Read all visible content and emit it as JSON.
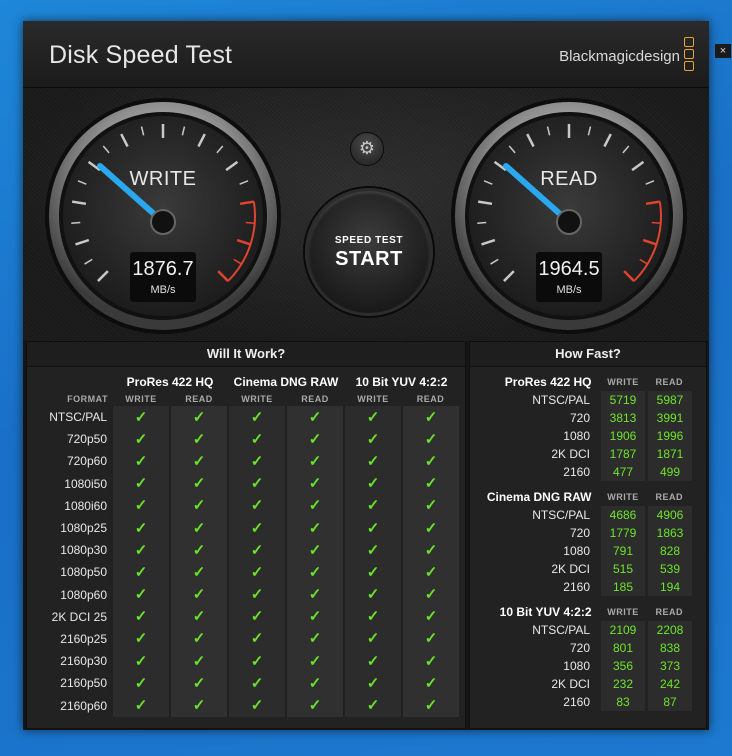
{
  "app": {
    "title": "Disk Speed Test",
    "brand": "Blackmagicdesign",
    "close_label": "×",
    "accent_color": "#e7a23a"
  },
  "gauges": {
    "write": {
      "label": "WRITE",
      "value": "1876.7",
      "unit": "MB/s"
    },
    "read": {
      "label": "READ",
      "value": "1964.5",
      "unit": "MB/s"
    }
  },
  "controls": {
    "settings_icon": "gear-icon",
    "start_small": "SPEED TEST",
    "start_big": "START"
  },
  "will_it_work": {
    "title": "Will It Work?",
    "format_header": "FORMAT",
    "write_label": "WRITE",
    "read_label": "READ",
    "check_mark": "✓",
    "check_color": "#69e22b",
    "codecs": [
      "ProRes 422 HQ",
      "Cinema DNG RAW",
      "10 Bit YUV 4:2:2"
    ],
    "formats": [
      "NTSC/PAL",
      "720p50",
      "720p60",
      "1080i50",
      "1080i60",
      "1080p25",
      "1080p30",
      "1080p50",
      "1080p60",
      "2K DCI 25",
      "2160p25",
      "2160p30",
      "2160p50",
      "2160p60"
    ]
  },
  "how_fast": {
    "title": "How Fast?",
    "write_label": "WRITE",
    "read_label": "READ",
    "sections": [
      {
        "codec": "ProRes 422 HQ",
        "rows": [
          {
            "label": "NTSC/PAL",
            "write": "5719",
            "read": "5987"
          },
          {
            "label": "720",
            "write": "3813",
            "read": "3991"
          },
          {
            "label": "1080",
            "write": "1906",
            "read": "1996"
          },
          {
            "label": "2K DCI",
            "write": "1787",
            "read": "1871"
          },
          {
            "label": "2160",
            "write": "477",
            "read": "499"
          }
        ]
      },
      {
        "codec": "Cinema DNG RAW",
        "rows": [
          {
            "label": "NTSC/PAL",
            "write": "4686",
            "read": "4906"
          },
          {
            "label": "720",
            "write": "1779",
            "read": "1863"
          },
          {
            "label": "1080",
            "write": "791",
            "read": "828"
          },
          {
            "label": "2K DCI",
            "write": "515",
            "read": "539"
          },
          {
            "label": "2160",
            "write": "185",
            "read": "194"
          }
        ]
      },
      {
        "codec": "10 Bit YUV 4:2:2",
        "rows": [
          {
            "label": "NTSC/PAL",
            "write": "2109",
            "read": "2208"
          },
          {
            "label": "720",
            "write": "801",
            "read": "838"
          },
          {
            "label": "1080",
            "write": "356",
            "read": "373"
          },
          {
            "label": "2K DCI",
            "write": "232",
            "read": "242"
          },
          {
            "label": "2160",
            "write": "83",
            "read": "87"
          }
        ]
      }
    ]
  }
}
